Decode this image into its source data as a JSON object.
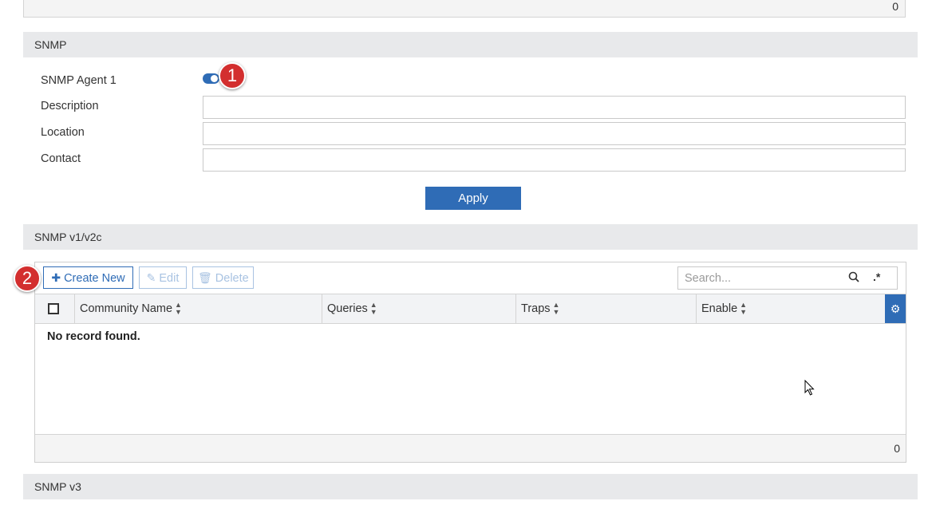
{
  "previous_table": {
    "count": "0"
  },
  "snmp_section": {
    "title": "SNMP",
    "agent_label": "SNMP Agent 1",
    "agent_enabled": true,
    "fields": [
      {
        "label": "Description",
        "value": ""
      },
      {
        "label": "Location",
        "value": ""
      },
      {
        "label": "Contact",
        "value": ""
      }
    ],
    "apply_label": "Apply"
  },
  "snmp_v1v2c_section": {
    "title": "SNMP v1/v2c",
    "toolbar": {
      "create_label": "Create New",
      "edit_label": "Edit",
      "delete_label": "Delete",
      "search_placeholder": "Search..."
    },
    "columns": [
      "Community Name",
      "Queries",
      "Traps",
      "Enable"
    ],
    "empty_message": "No record found.",
    "count": "0"
  },
  "snmp_v3_section": {
    "title": "SNMP v3"
  },
  "callouts": [
    "1",
    "2"
  ],
  "icons": {
    "create": "plus-icon",
    "edit": "edit-icon",
    "delete": "trash-icon",
    "search": "search-icon",
    "regex": "regex-icon",
    "sort": "sort-icon",
    "settings": "gear-icon",
    "cursor": "mouse-pointer-icon"
  },
  "colors": {
    "accent": "#2f6cb6",
    "badge": "#d32f2f",
    "section_header_bg": "#e8e9eb",
    "disabled": "#a9c3e2"
  }
}
